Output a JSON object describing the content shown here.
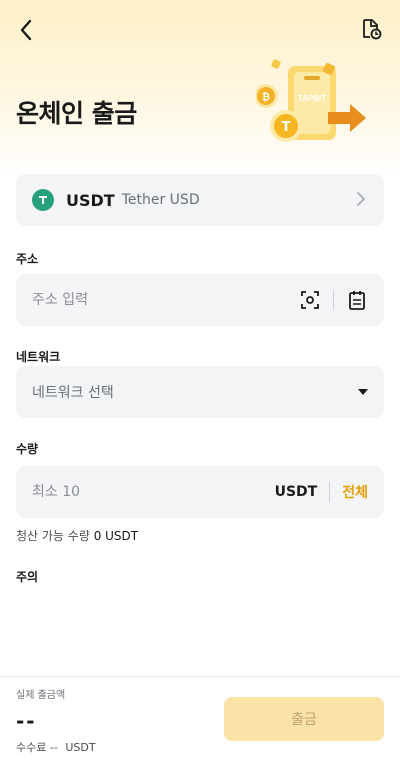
{
  "header": {
    "title": "온체인 출금"
  },
  "hero": {
    "brand_text": "TAPBIT"
  },
  "coin": {
    "symbol": "USDT",
    "name": "Tether USD"
  },
  "address": {
    "label": "주소",
    "placeholder": "주소 입력"
  },
  "network": {
    "label": "네트워크",
    "selected": "네트워크 선택"
  },
  "amount": {
    "label": "수량",
    "placeholder": "최소 10",
    "unit": "USDT",
    "max_label": "전체"
  },
  "available": {
    "label": "청산 가능 수량",
    "value": "0 USDT"
  },
  "notice": {
    "label": "주의"
  },
  "footer": {
    "receive_label": "실제 출금액",
    "receive_amount": "--",
    "fee_label": "수수료",
    "fee_value": "--",
    "fee_unit": "USDT",
    "withdraw_button": "출금"
  },
  "colors": {
    "accent": "#e3a008",
    "usdt_green": "#26a17b",
    "button_disabled": "#fbe3a7"
  }
}
